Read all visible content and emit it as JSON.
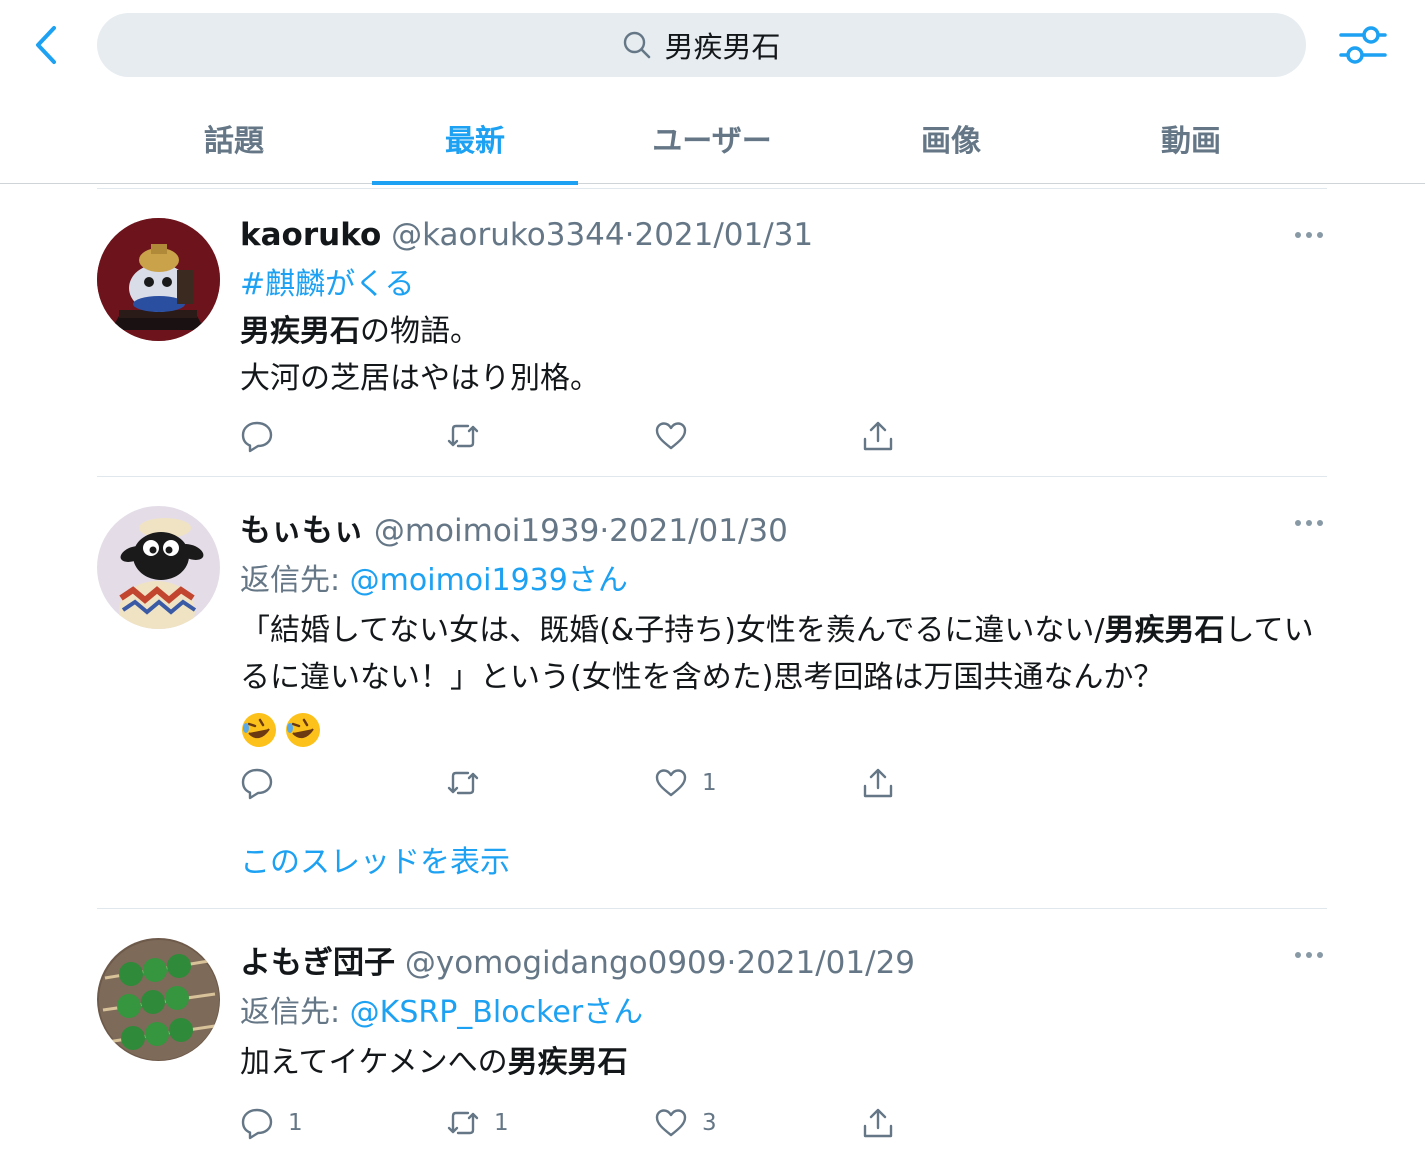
{
  "search": {
    "query": "男疾男石"
  },
  "tabs": [
    {
      "label": "話題"
    },
    {
      "label": "最新",
      "active": true
    },
    {
      "label": "ユーザー"
    },
    {
      "label": "画像"
    },
    {
      "label": "動画"
    }
  ],
  "tweets": [
    {
      "name": "kaoruko",
      "handle": "@kaoruko3344",
      "dot": "·",
      "date": "2021/01/31",
      "hashtag": "#麒麟がくる",
      "line1_bold": "男疾男石",
      "line1_rest": "の物語。",
      "line2": "大河の芝居はやはり別格。",
      "counts": {
        "reply": "",
        "retweet": "",
        "like": ""
      }
    },
    {
      "name": "もぃもぃ",
      "handle": "@moimoi1939",
      "dot": "·",
      "date": "2021/01/30",
      "reply_prefix": "返信先: ",
      "reply_mention": "@moimoi1939さん",
      "text_a": "「結婚してない女は、既婚(&子持ち)女性を羨んでるに違いない/",
      "text_bold": "男疾男石",
      "text_b": "しているに違いない！」という(女性を含めた)思考回路は万国共通なんか？",
      "counts": {
        "reply": "",
        "retweet": "",
        "like": "1"
      },
      "thread_link": "このスレッドを表示"
    },
    {
      "name": "よもぎ団子",
      "handle": "@yomogidango0909",
      "dot": "·",
      "date": "2021/01/29",
      "reply_prefix": "返信先: ",
      "reply_mention": "@KSRP_Blockerさん",
      "text_a": "加えてイケメンへの",
      "text_bold": "男疾男石",
      "counts": {
        "reply": "1",
        "retweet": "1",
        "like": "3"
      }
    }
  ],
  "colors": {
    "accent": "#1da1f2",
    "secondary_text": "#657786",
    "search_bg": "#e6ecf0"
  },
  "icons": [
    "back-chevron-icon",
    "search-icon",
    "filter-sliders-icon",
    "more-icon",
    "reply-icon",
    "retweet-icon",
    "like-icon",
    "share-icon",
    "rofl-emoji-icon"
  ]
}
